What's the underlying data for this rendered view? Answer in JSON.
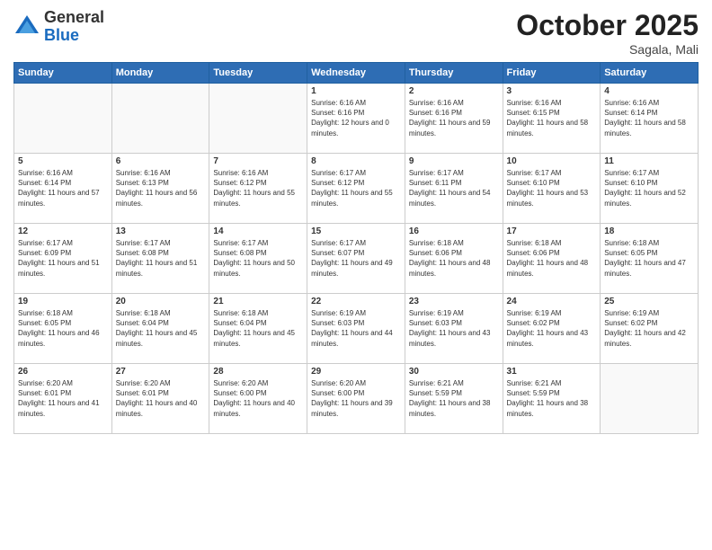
{
  "logo": {
    "general": "General",
    "blue": "Blue"
  },
  "header": {
    "month": "October 2025",
    "location": "Sagala, Mali"
  },
  "weekdays": [
    "Sunday",
    "Monday",
    "Tuesday",
    "Wednesday",
    "Thursday",
    "Friday",
    "Saturday"
  ],
  "weeks": [
    [
      {
        "day": "",
        "sunrise": "",
        "sunset": "",
        "daylight": ""
      },
      {
        "day": "",
        "sunrise": "",
        "sunset": "",
        "daylight": ""
      },
      {
        "day": "",
        "sunrise": "",
        "sunset": "",
        "daylight": ""
      },
      {
        "day": "1",
        "sunrise": "6:16 AM",
        "sunset": "6:16 PM",
        "daylight": "12 hours and 0 minutes."
      },
      {
        "day": "2",
        "sunrise": "6:16 AM",
        "sunset": "6:16 PM",
        "daylight": "11 hours and 59 minutes."
      },
      {
        "day": "3",
        "sunrise": "6:16 AM",
        "sunset": "6:15 PM",
        "daylight": "11 hours and 58 minutes."
      },
      {
        "day": "4",
        "sunrise": "6:16 AM",
        "sunset": "6:14 PM",
        "daylight": "11 hours and 58 minutes."
      }
    ],
    [
      {
        "day": "5",
        "sunrise": "6:16 AM",
        "sunset": "6:14 PM",
        "daylight": "11 hours and 57 minutes."
      },
      {
        "day": "6",
        "sunrise": "6:16 AM",
        "sunset": "6:13 PM",
        "daylight": "11 hours and 56 minutes."
      },
      {
        "day": "7",
        "sunrise": "6:16 AM",
        "sunset": "6:12 PM",
        "daylight": "11 hours and 55 minutes."
      },
      {
        "day": "8",
        "sunrise": "6:17 AM",
        "sunset": "6:12 PM",
        "daylight": "11 hours and 55 minutes."
      },
      {
        "day": "9",
        "sunrise": "6:17 AM",
        "sunset": "6:11 PM",
        "daylight": "11 hours and 54 minutes."
      },
      {
        "day": "10",
        "sunrise": "6:17 AM",
        "sunset": "6:10 PM",
        "daylight": "11 hours and 53 minutes."
      },
      {
        "day": "11",
        "sunrise": "6:17 AM",
        "sunset": "6:10 PM",
        "daylight": "11 hours and 52 minutes."
      }
    ],
    [
      {
        "day": "12",
        "sunrise": "6:17 AM",
        "sunset": "6:09 PM",
        "daylight": "11 hours and 51 minutes."
      },
      {
        "day": "13",
        "sunrise": "6:17 AM",
        "sunset": "6:08 PM",
        "daylight": "11 hours and 51 minutes."
      },
      {
        "day": "14",
        "sunrise": "6:17 AM",
        "sunset": "6:08 PM",
        "daylight": "11 hours and 50 minutes."
      },
      {
        "day": "15",
        "sunrise": "6:17 AM",
        "sunset": "6:07 PM",
        "daylight": "11 hours and 49 minutes."
      },
      {
        "day": "16",
        "sunrise": "6:18 AM",
        "sunset": "6:06 PM",
        "daylight": "11 hours and 48 minutes."
      },
      {
        "day": "17",
        "sunrise": "6:18 AM",
        "sunset": "6:06 PM",
        "daylight": "11 hours and 48 minutes."
      },
      {
        "day": "18",
        "sunrise": "6:18 AM",
        "sunset": "6:05 PM",
        "daylight": "11 hours and 47 minutes."
      }
    ],
    [
      {
        "day": "19",
        "sunrise": "6:18 AM",
        "sunset": "6:05 PM",
        "daylight": "11 hours and 46 minutes."
      },
      {
        "day": "20",
        "sunrise": "6:18 AM",
        "sunset": "6:04 PM",
        "daylight": "11 hours and 45 minutes."
      },
      {
        "day": "21",
        "sunrise": "6:18 AM",
        "sunset": "6:04 PM",
        "daylight": "11 hours and 45 minutes."
      },
      {
        "day": "22",
        "sunrise": "6:19 AM",
        "sunset": "6:03 PM",
        "daylight": "11 hours and 44 minutes."
      },
      {
        "day": "23",
        "sunrise": "6:19 AM",
        "sunset": "6:03 PM",
        "daylight": "11 hours and 43 minutes."
      },
      {
        "day": "24",
        "sunrise": "6:19 AM",
        "sunset": "6:02 PM",
        "daylight": "11 hours and 43 minutes."
      },
      {
        "day": "25",
        "sunrise": "6:19 AM",
        "sunset": "6:02 PM",
        "daylight": "11 hours and 42 minutes."
      }
    ],
    [
      {
        "day": "26",
        "sunrise": "6:20 AM",
        "sunset": "6:01 PM",
        "daylight": "11 hours and 41 minutes."
      },
      {
        "day": "27",
        "sunrise": "6:20 AM",
        "sunset": "6:01 PM",
        "daylight": "11 hours and 40 minutes."
      },
      {
        "day": "28",
        "sunrise": "6:20 AM",
        "sunset": "6:00 PM",
        "daylight": "11 hours and 40 minutes."
      },
      {
        "day": "29",
        "sunrise": "6:20 AM",
        "sunset": "6:00 PM",
        "daylight": "11 hours and 39 minutes."
      },
      {
        "day": "30",
        "sunrise": "6:21 AM",
        "sunset": "5:59 PM",
        "daylight": "11 hours and 38 minutes."
      },
      {
        "day": "31",
        "sunrise": "6:21 AM",
        "sunset": "5:59 PM",
        "daylight": "11 hours and 38 minutes."
      },
      {
        "day": "",
        "sunrise": "",
        "sunset": "",
        "daylight": ""
      }
    ]
  ],
  "labels": {
    "sunrise_prefix": "Sunrise: ",
    "sunset_prefix": "Sunset: ",
    "daylight_prefix": "Daylight: "
  }
}
